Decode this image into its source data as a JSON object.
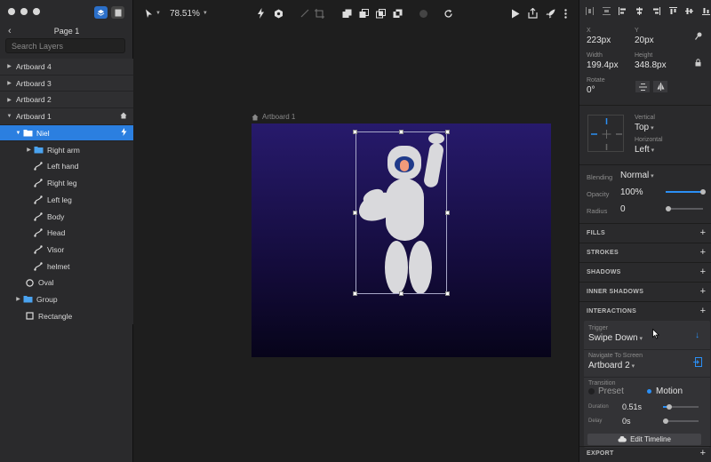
{
  "left_panel": {
    "page_title": "Page 1",
    "search_placeholder": "Search Layers",
    "layers": [
      {
        "label": "Artboard 4",
        "kind": "artboard"
      },
      {
        "label": "Artboard 3",
        "kind": "artboard"
      },
      {
        "label": "Artboard 2",
        "kind": "artboard"
      },
      {
        "label": "Artboard 1",
        "kind": "artboard"
      },
      {
        "label": "Niel",
        "kind": "group",
        "selected": true
      },
      {
        "label": "Right arm",
        "kind": "group"
      },
      {
        "label": "Left hand",
        "kind": "path"
      },
      {
        "label": "Right leg",
        "kind": "path"
      },
      {
        "label": "Left leg",
        "kind": "path"
      },
      {
        "label": "Body",
        "kind": "path"
      },
      {
        "label": "Head",
        "kind": "path"
      },
      {
        "label": "Visor",
        "kind": "path"
      },
      {
        "label": "helmet",
        "kind": "path"
      },
      {
        "label": "Oval",
        "kind": "oval"
      },
      {
        "label": "Group",
        "kind": "group"
      },
      {
        "label": "Rectangle",
        "kind": "rectangle"
      }
    ]
  },
  "toolbar": {
    "zoom": "78.51%"
  },
  "canvas": {
    "artboard_label": "Artboard 1"
  },
  "inspector": {
    "x_label": "X",
    "x_value": "223px",
    "y_label": "Y",
    "y_value": "20px",
    "width_label": "Width",
    "width_value": "199.4px",
    "height_label": "Height",
    "height_value": "348.8px",
    "rotate_label": "Rotate",
    "rotate_value": "0°",
    "vertical_label": "Vertical",
    "vertical_value": "Top",
    "horizontal_label": "Horizontal",
    "horizontal_value": "Left",
    "blending_label": "Blending",
    "blending_value": "Normal",
    "opacity_label": "Opacity",
    "opacity_value": "100%",
    "opacity_level": 1.0,
    "radius_label": "Radius",
    "radius_value": "0",
    "sections": {
      "fills": "FILLS",
      "strokes": "STROKES",
      "shadows": "SHADOWS",
      "inner_shadows": "INNER SHADOWS",
      "interactions": "INTERACTIONS",
      "export": "EXPORT"
    },
    "trigger_label": "Trigger",
    "trigger_value": "Swipe Down",
    "navigate_label": "Navigate To Screen",
    "navigate_value": "Artboard 2",
    "transition_label": "Transition",
    "preset_label": "Preset",
    "motion_label": "Motion",
    "duration_label": "Duration",
    "duration_value": "0.51s",
    "delay_label": "Delay",
    "delay_value": "0s",
    "edit_timeline_label": "Edit Timeline"
  },
  "colors": {
    "accent": "#2b7fe0",
    "artboard_top": "#271a6c",
    "artboard_bottom": "#07041a",
    "astronaut": "#d9d9dc",
    "visor": "#1f3a8a",
    "face": "#f29a7a"
  }
}
